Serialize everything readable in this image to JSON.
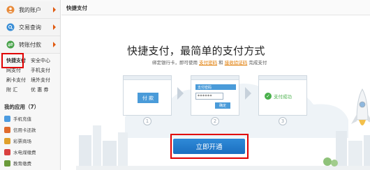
{
  "sidebar": {
    "nav": [
      {
        "label": "我的账户",
        "icon": "user-icon"
      },
      {
        "label": "交易查询",
        "icon": "search-icon"
      },
      {
        "label": "转账付款",
        "icon": "transfer-icon"
      }
    ],
    "sub_links": [
      "快捷支付",
      "安全中心",
      "网支付",
      "手机支付",
      "刷卡支付",
      "境外支付",
      "附 汇",
      "优 惠 券"
    ],
    "apps_title": "我的应用（7）",
    "apps": [
      {
        "label": "手机充值",
        "color": "#4c9be0"
      },
      {
        "label": "信用卡还款",
        "color": "#e06a2b"
      },
      {
        "label": "彩票商场",
        "color": "#e0a02b"
      },
      {
        "label": "水电煤缴费",
        "color": "#d94040"
      },
      {
        "label": "教育缴费",
        "color": "#6a9a3a"
      }
    ]
  },
  "main": {
    "tab_label": "快捷支付",
    "headline": "快捷支付，最简单的支付方式",
    "subline_prefix": "绑定银行卡，即可使用",
    "subline_link1": "支付密码",
    "subline_mid": "和",
    "subline_link2": "接收验证码",
    "subline_suffix": "完成支付",
    "steps": {
      "step1_chip": "付 款",
      "step2_label": "支付密码",
      "step2_value": "******",
      "step2_btn": "确定",
      "step3_text": "支付成功"
    },
    "step_numbers": [
      "1",
      "2",
      "3"
    ],
    "cta_label": "立即开通"
  },
  "colors": {
    "accent_blue": "#1b6fc0",
    "highlight_orange": "#e07a00",
    "annotation_red": "#e10000"
  }
}
